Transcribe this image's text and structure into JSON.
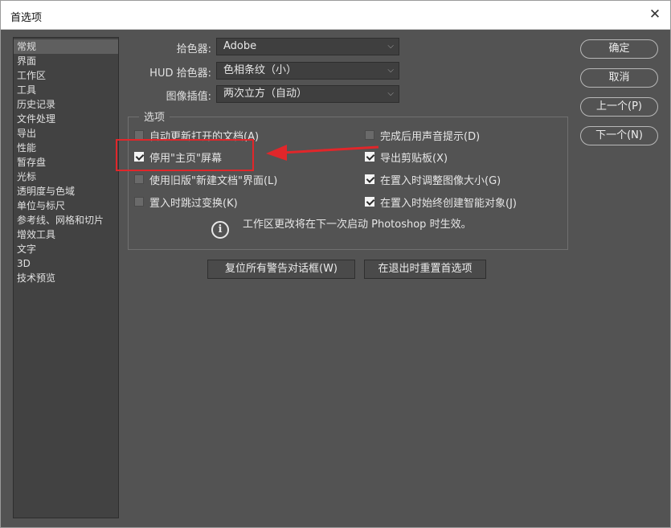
{
  "window": {
    "title": "首选项"
  },
  "icons": {
    "close": "close-icon",
    "chevron": "chevron-down-icon",
    "info": "info-icon",
    "check": "check-icon"
  },
  "colors": {
    "annotation": "#e1262a",
    "panel": "#535353",
    "sidebar": "#424242"
  },
  "sidebar": {
    "items": [
      {
        "label": "常规",
        "selected": true
      },
      {
        "label": "界面"
      },
      {
        "label": "工作区"
      },
      {
        "label": "工具"
      },
      {
        "label": "历史记录"
      },
      {
        "label": "文件处理"
      },
      {
        "label": "导出"
      },
      {
        "label": "性能"
      },
      {
        "label": "暂存盘"
      },
      {
        "label": "光标"
      },
      {
        "label": "透明度与色域"
      },
      {
        "label": "单位与标尺"
      },
      {
        "label": "参考线、网格和切片"
      },
      {
        "label": "增效工具"
      },
      {
        "label": "文字"
      },
      {
        "label": "3D"
      },
      {
        "label": "技术预览"
      }
    ]
  },
  "settings": {
    "color_picker": {
      "label": "拾色器:",
      "value": "Adobe"
    },
    "hud_picker": {
      "label": "HUD 拾色器:",
      "value": "色相条纹（小）"
    },
    "interpolation": {
      "label": "图像插值:",
      "value": "两次立方（自动）"
    }
  },
  "options": {
    "legend": "选项",
    "left": [
      {
        "label": "自动更新打开的文档(A)",
        "checked": false
      },
      {
        "label": "停用\"主页\"屏幕",
        "checked": true
      },
      {
        "label": "使用旧版\"新建文档\"界面(L)",
        "checked": false
      },
      {
        "label": "置入时跳过变换(K)",
        "checked": false
      }
    ],
    "right": [
      {
        "label": "完成后用声音提示(D)",
        "checked": false
      },
      {
        "label": "导出剪贴板(X)",
        "checked": true
      },
      {
        "label": "在置入时调整图像大小(G)",
        "checked": true
      },
      {
        "label": "在置入时始终创建智能对象(J)",
        "checked": true
      }
    ],
    "info": "工作区更改将在下一次启动 Photoshop 时生效。"
  },
  "buttons": {
    "reset_warnings": "复位所有警告对话框(W)",
    "reset_on_quit": "在退出时重置首选项",
    "ok": "确定",
    "cancel": "取消",
    "prev": "上一个(P)",
    "next": "下一个(N)"
  }
}
